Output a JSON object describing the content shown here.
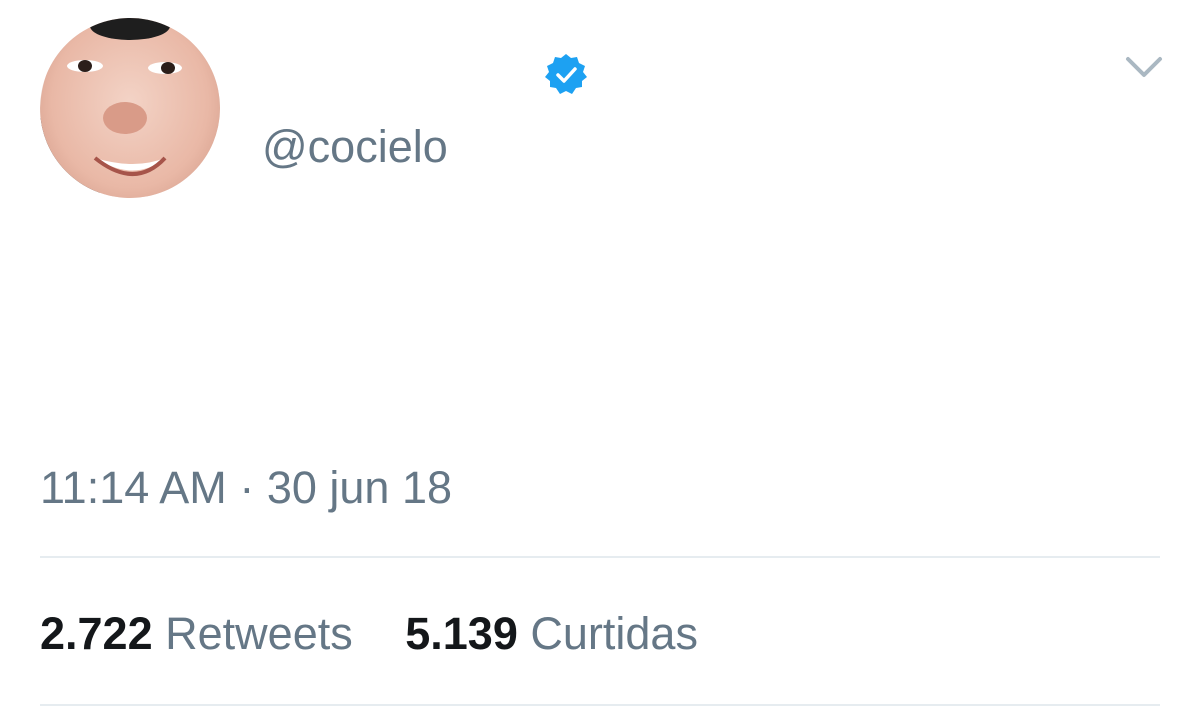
{
  "tweet": {
    "handle": "@cocielo",
    "verified": true,
    "avatar_icon": "profile-photo",
    "timestamp": {
      "time": "11:14 AM",
      "separator": "·",
      "date": "30 jun 18"
    },
    "stats": {
      "retweets": {
        "count": "2.722",
        "label": "Retweets"
      },
      "likes": {
        "count": "5.139",
        "label": "Curtidas"
      }
    }
  },
  "colors": {
    "secondary_text": "#657786",
    "primary_text": "#14171a",
    "verified_blue": "#1da1f2",
    "divider": "#e6ecf0",
    "chevron": "#aab8c2"
  },
  "icons": {
    "verified": "verified-badge-icon",
    "menu": "chevron-down-icon"
  }
}
